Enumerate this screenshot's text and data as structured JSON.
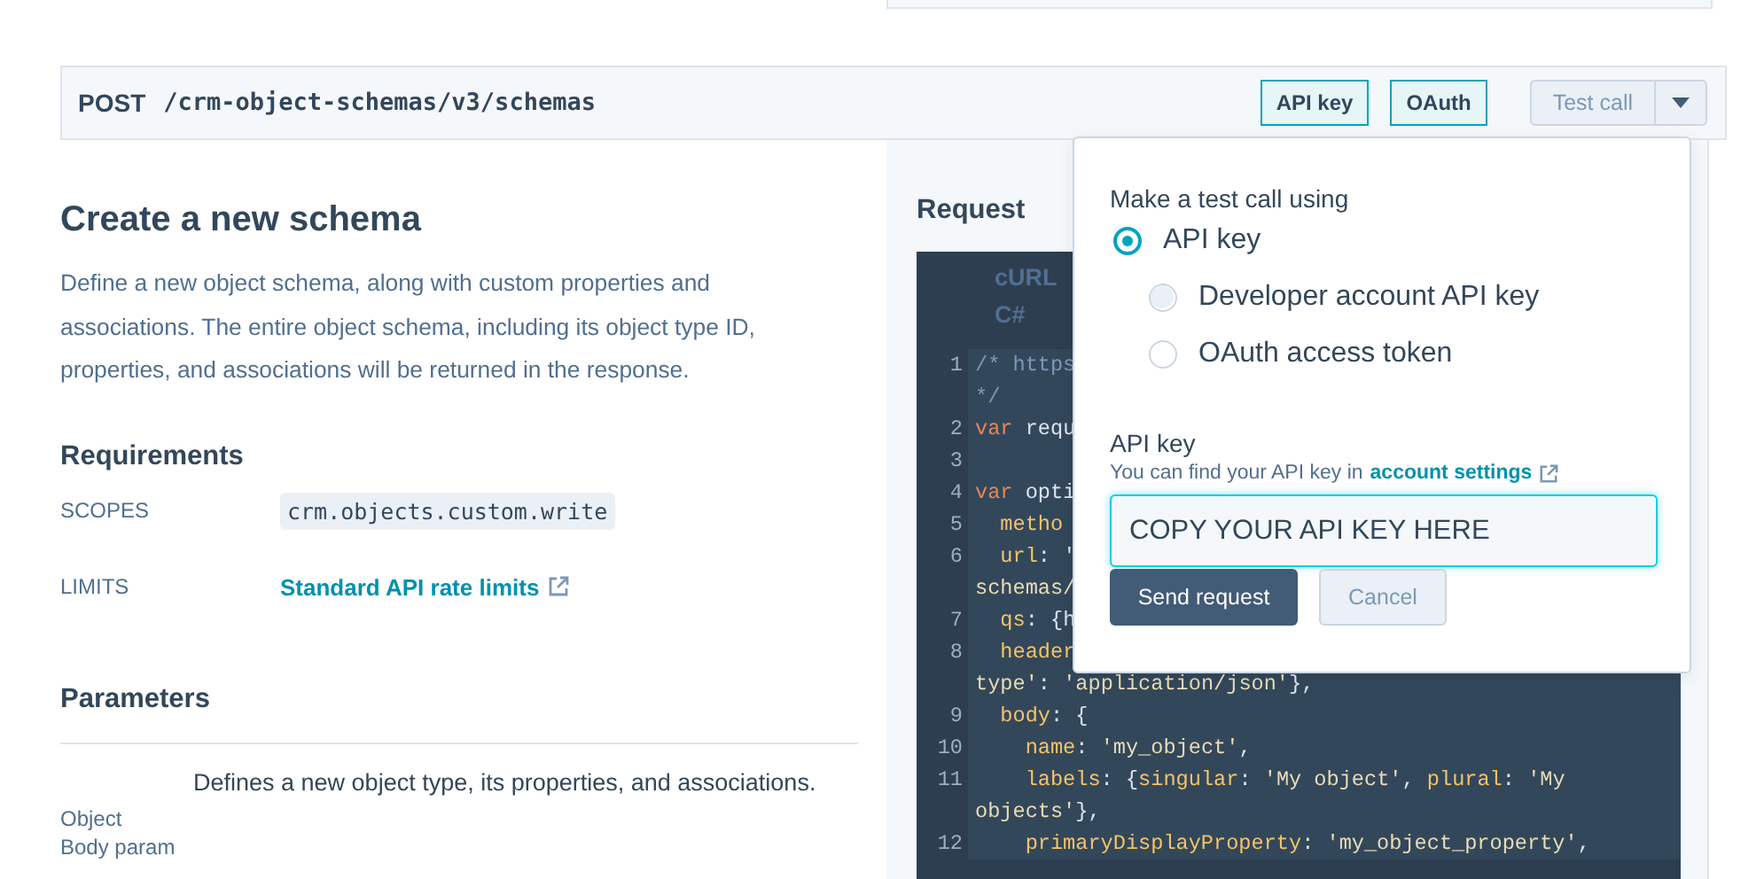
{
  "endpoint": {
    "method": "POST",
    "path": "/crm-object-schemas/v3/schemas",
    "auth_tags": [
      "API key",
      "OAuth"
    ],
    "test_button": "Test call"
  },
  "doc": {
    "title": "Create a new schema",
    "description": "Define a new object schema, along with custom properties and associations. The entire object schema, including its object type ID, properties, and associations will be returned in the response.",
    "requirements_heading": "Requirements",
    "requirements": [
      {
        "label": "SCOPES",
        "kind": "code",
        "value": "crm.objects.custom.write"
      },
      {
        "label": "LIMITS",
        "kind": "link",
        "value": "Standard API rate limits"
      }
    ],
    "parameters_heading": "Parameters",
    "parameter": {
      "description": "Defines a new object type, its properties, and associations.",
      "type": "Object",
      "location": "Body param"
    }
  },
  "request": {
    "heading": "Request",
    "languages": [
      "cURL",
      "C#"
    ],
    "code": [
      {
        "num": "1",
        "tokens": [
          {
            "t": "/* https",
            "kind": "comment"
          }
        ]
      },
      {
        "tokens": [
          {
            "t": "*/",
            "kind": "comment"
          }
        ]
      },
      {
        "num": "2",
        "tokens": [
          {
            "t": "var",
            "kind": "kw"
          },
          {
            "t": " requ",
            "kind": "plain"
          }
        ]
      },
      {
        "num": "3"
      },
      {
        "num": "4",
        "tokens": [
          {
            "t": "var",
            "kind": "kw"
          },
          {
            "t": " opti",
            "kind": "plain"
          }
        ]
      },
      {
        "num": "5",
        "tokens": [
          {
            "t": "  metho",
            "kind": "prop"
          }
        ]
      },
      {
        "num": "6",
        "tokens": [
          {
            "t": "  url",
            "kind": "prop"
          },
          {
            "t": ": '",
            "kind": "plain"
          }
        ]
      },
      {
        "tokens": [
          {
            "t": "schemas/",
            "kind": "str"
          }
        ]
      },
      {
        "num": "7",
        "tokens": [
          {
            "t": "  qs",
            "kind": "prop"
          },
          {
            "t": ": {h",
            "kind": "plain"
          }
        ]
      },
      {
        "num": "8",
        "tokens": [
          {
            "t": "  header",
            "kind": "prop"
          }
        ]
      },
      {
        "tokens": [
          {
            "t": "type'",
            "kind": "str"
          },
          {
            "t": ": ",
            "kind": "plain"
          },
          {
            "t": "'application/json'",
            "kind": "str"
          },
          {
            "t": "},",
            "kind": "plain"
          }
        ]
      },
      {
        "num": "9",
        "tokens": [
          {
            "t": "  body",
            "kind": "prop"
          },
          {
            "t": ": {",
            "kind": "plain"
          }
        ]
      },
      {
        "num": "10",
        "tokens": [
          {
            "t": "    name",
            "kind": "prop"
          },
          {
            "t": ": ",
            "kind": "plain"
          },
          {
            "t": "'my_object'",
            "kind": "str"
          },
          {
            "t": ",",
            "kind": "plain"
          }
        ]
      },
      {
        "num": "11",
        "tokens": [
          {
            "t": "    labels",
            "kind": "prop"
          },
          {
            "t": ": {",
            "kind": "plain"
          },
          {
            "t": "singular",
            "kind": "prop"
          },
          {
            "t": ": ",
            "kind": "plain"
          },
          {
            "t": "'My object'",
            "kind": "str"
          },
          {
            "t": ", ",
            "kind": "plain"
          },
          {
            "t": "plural",
            "kind": "prop"
          },
          {
            "t": ": ",
            "kind": "plain"
          },
          {
            "t": "'My",
            "kind": "str"
          }
        ]
      },
      {
        "tokens": [
          {
            "t": "objects'",
            "kind": "str"
          },
          {
            "t": "},",
            "kind": "plain"
          }
        ]
      },
      {
        "num": "12",
        "tokens": [
          {
            "t": "    primaryDisplayProperty",
            "kind": "prop"
          },
          {
            "t": ": ",
            "kind": "plain"
          },
          {
            "t": "'my_object_property'",
            "kind": "str"
          },
          {
            "t": ",",
            "kind": "plain"
          }
        ]
      }
    ]
  },
  "test_popover": {
    "heading": "Make a test call using",
    "options": [
      {
        "label": "API key",
        "selected": true,
        "highlighted": false,
        "children": [
          {
            "label": "Developer account API key",
            "selected": false,
            "highlighted": true
          },
          {
            "label": "OAuth access token",
            "selected": false,
            "highlighted": false
          }
        ]
      }
    ],
    "key_label": "API key",
    "hint": "You can find your API key in",
    "hint_link": "account settings",
    "key_value": "COPY YOUR API KEY HERE",
    "send_button": "Send request",
    "cancel_button": "Cancel"
  }
}
